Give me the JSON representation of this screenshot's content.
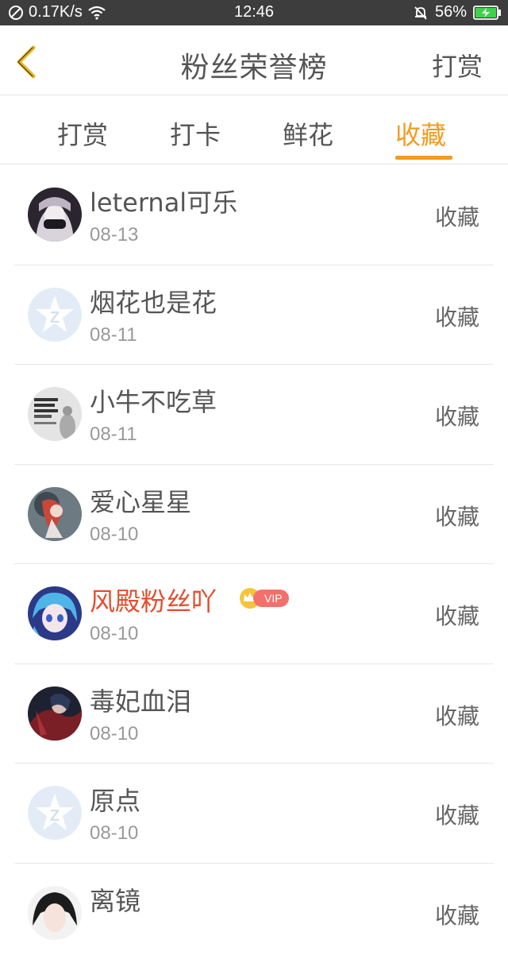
{
  "status_bar": {
    "speed": "0.17K/s",
    "time": "12:46",
    "battery": "56%"
  },
  "header": {
    "title": "粉丝荣誉榜",
    "action": "打赏"
  },
  "tabs": [
    {
      "label": "打赏",
      "active": false
    },
    {
      "label": "打卡",
      "active": false
    },
    {
      "label": "鲜花",
      "active": false
    },
    {
      "label": "收藏",
      "active": true
    }
  ],
  "list": [
    {
      "name": "leternal可乐",
      "date": "08-13",
      "action": "收藏",
      "vip": false,
      "avatar": "dark-anime"
    },
    {
      "name": "烟花也是花",
      "date": "08-11",
      "action": "收藏",
      "vip": false,
      "avatar": "default-star"
    },
    {
      "name": "小牛不吃草",
      "date": "08-11",
      "action": "收藏",
      "vip": false,
      "avatar": "text-photo"
    },
    {
      "name": "爱心星星",
      "date": "08-10",
      "action": "收藏",
      "vip": false,
      "avatar": "red-art"
    },
    {
      "name": "风殿粉丝吖",
      "date": "08-10",
      "action": "收藏",
      "vip": true,
      "vip_label": "VIP",
      "avatar": "blue-anime"
    },
    {
      "name": "毒妃血泪",
      "date": "08-10",
      "action": "收藏",
      "vip": false,
      "avatar": "dark-red"
    },
    {
      "name": "原点",
      "date": "08-10",
      "action": "收藏",
      "vip": false,
      "avatar": "default-star"
    },
    {
      "name": "离镜",
      "date": "",
      "action": "收藏",
      "vip": false,
      "avatar": "portrait"
    }
  ],
  "colors": {
    "accent": "#f29c1f",
    "vip_name": "#e44d2e",
    "status_bar": "#3d3d3d"
  }
}
